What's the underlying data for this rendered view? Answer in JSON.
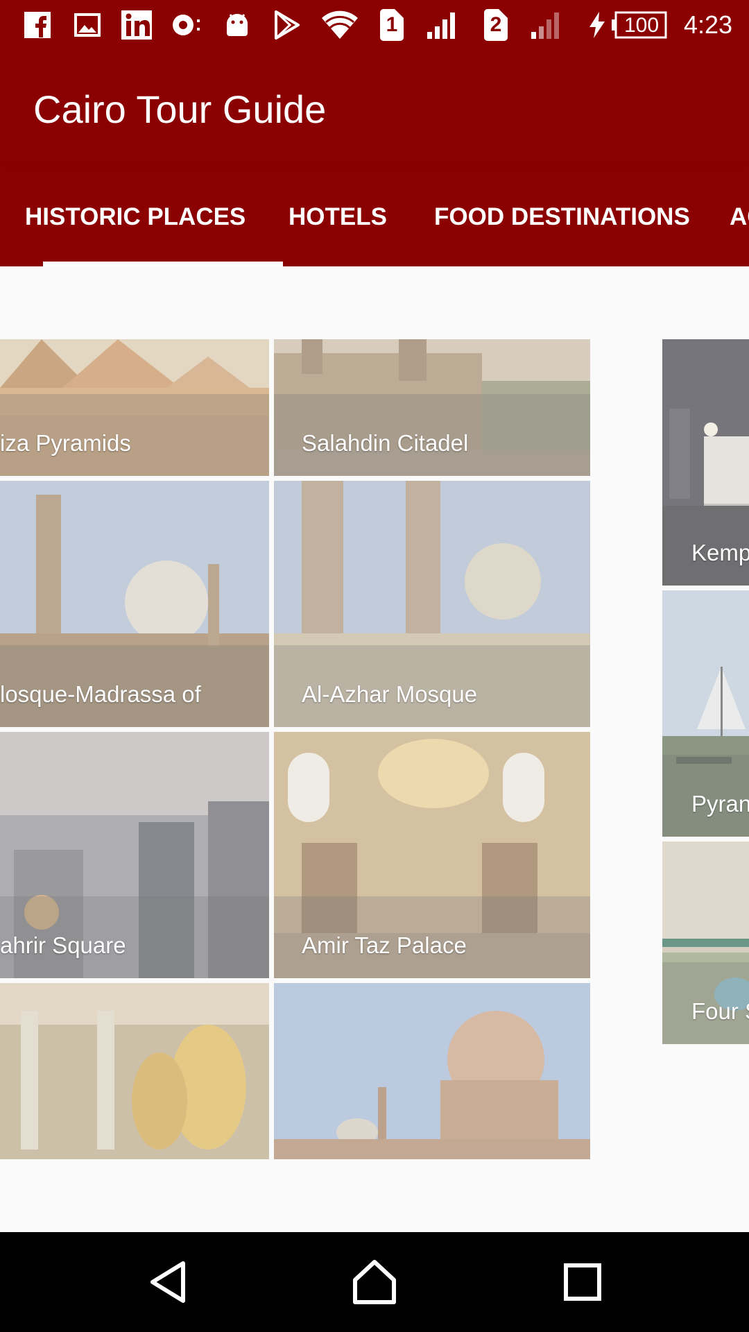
{
  "status_bar": {
    "time": "4:23",
    "battery": "100",
    "sim1": "1",
    "sim2": "2",
    "icons": [
      "facebook-icon",
      "gallery-icon",
      "linkedin-icon",
      "camera-icon",
      "android-icon",
      "play-store-icon",
      "wifi-icon",
      "signal-icon",
      "signal-icon",
      "charging-icon",
      "battery-icon"
    ]
  },
  "app_bar": {
    "title": "Cairo Tour Guide"
  },
  "tabs": [
    {
      "label": "HISTORIC PLACES",
      "selected": true
    },
    {
      "label": "HOTELS",
      "selected": false
    },
    {
      "label": "FOOD DESTINATIONS",
      "selected": false
    },
    {
      "label": "AC",
      "selected": false
    }
  ],
  "historic_places": [
    {
      "name": "iza Pyramids"
    },
    {
      "name": "Salahdin Citadel"
    },
    {
      "name": "losque-Madrassa of"
    },
    {
      "name": "Al-Azhar Mosque"
    },
    {
      "name": "ahrir Square"
    },
    {
      "name": "Amir Taz Palace"
    },
    {
      "name": ""
    },
    {
      "name": ""
    }
  ],
  "hotels": [
    {
      "name": "Kemp"
    },
    {
      "name": "Pyran"
    },
    {
      "name": "Four S"
    }
  ],
  "nav_bar": {
    "buttons": [
      "back-icon",
      "home-icon",
      "recents-icon"
    ]
  },
  "colors": {
    "primary": "#8B0000",
    "indicator": "#FFFFFF",
    "background": "#FAFAFA"
  }
}
